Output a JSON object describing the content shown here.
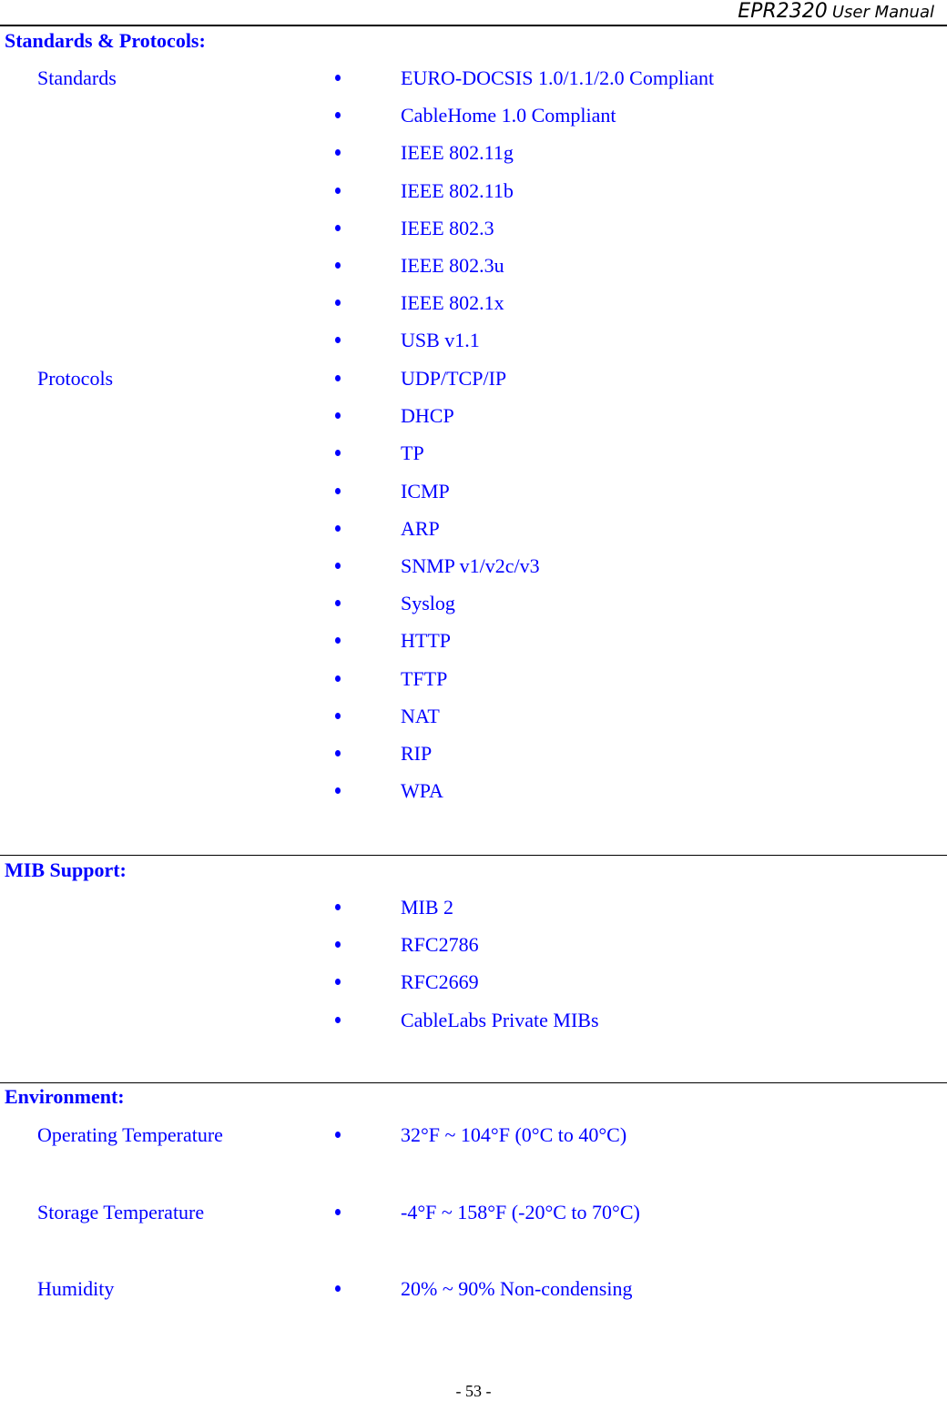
{
  "header": {
    "model": "EPR2320",
    "title": "User Manual"
  },
  "colors": {
    "text_accent": "#0000ff",
    "rule": "#000000"
  },
  "sections": {
    "standards_protocols": {
      "title": "Standards & Protocols:",
      "standards_label": "Standards",
      "standards": [
        "EURO-DOCSIS 1.0/1.1/2.0 Compliant",
        "CableHome 1.0 Compliant",
        "IEEE 802.11g",
        "IEEE 802.11b",
        "IEEE 802.3",
        "IEEE 802.3u",
        "IEEE 802.1x",
        "USB v1.1"
      ],
      "protocols_label": "Protocols",
      "protocols": [
        "UDP/TCP/IP",
        "DHCP",
        "TP",
        "ICMP",
        "ARP",
        "SNMP v1/v2c/v3",
        "Syslog",
        "HTTP",
        "TFTP",
        "NAT",
        "RIP",
        "WPA"
      ]
    },
    "mib_support": {
      "title": "MIB Support:",
      "items": [
        "MIB 2",
        "RFC2786",
        "RFC2669",
        "CableLabs Private MIBs"
      ]
    },
    "environment": {
      "title": "Environment:",
      "items": [
        {
          "label": "Operating Temperature",
          "value": "32°F ~ 104°F (0°C to 40°C)"
        },
        {
          "label": "Storage Temperature",
          "value": "-4°F ~ 158°F (-20°C to 70°C)"
        },
        {
          "label": "Humidity",
          "value": "20% ~ 90% Non-condensing"
        }
      ]
    }
  },
  "footer": {
    "page_number": "- 53 -"
  }
}
